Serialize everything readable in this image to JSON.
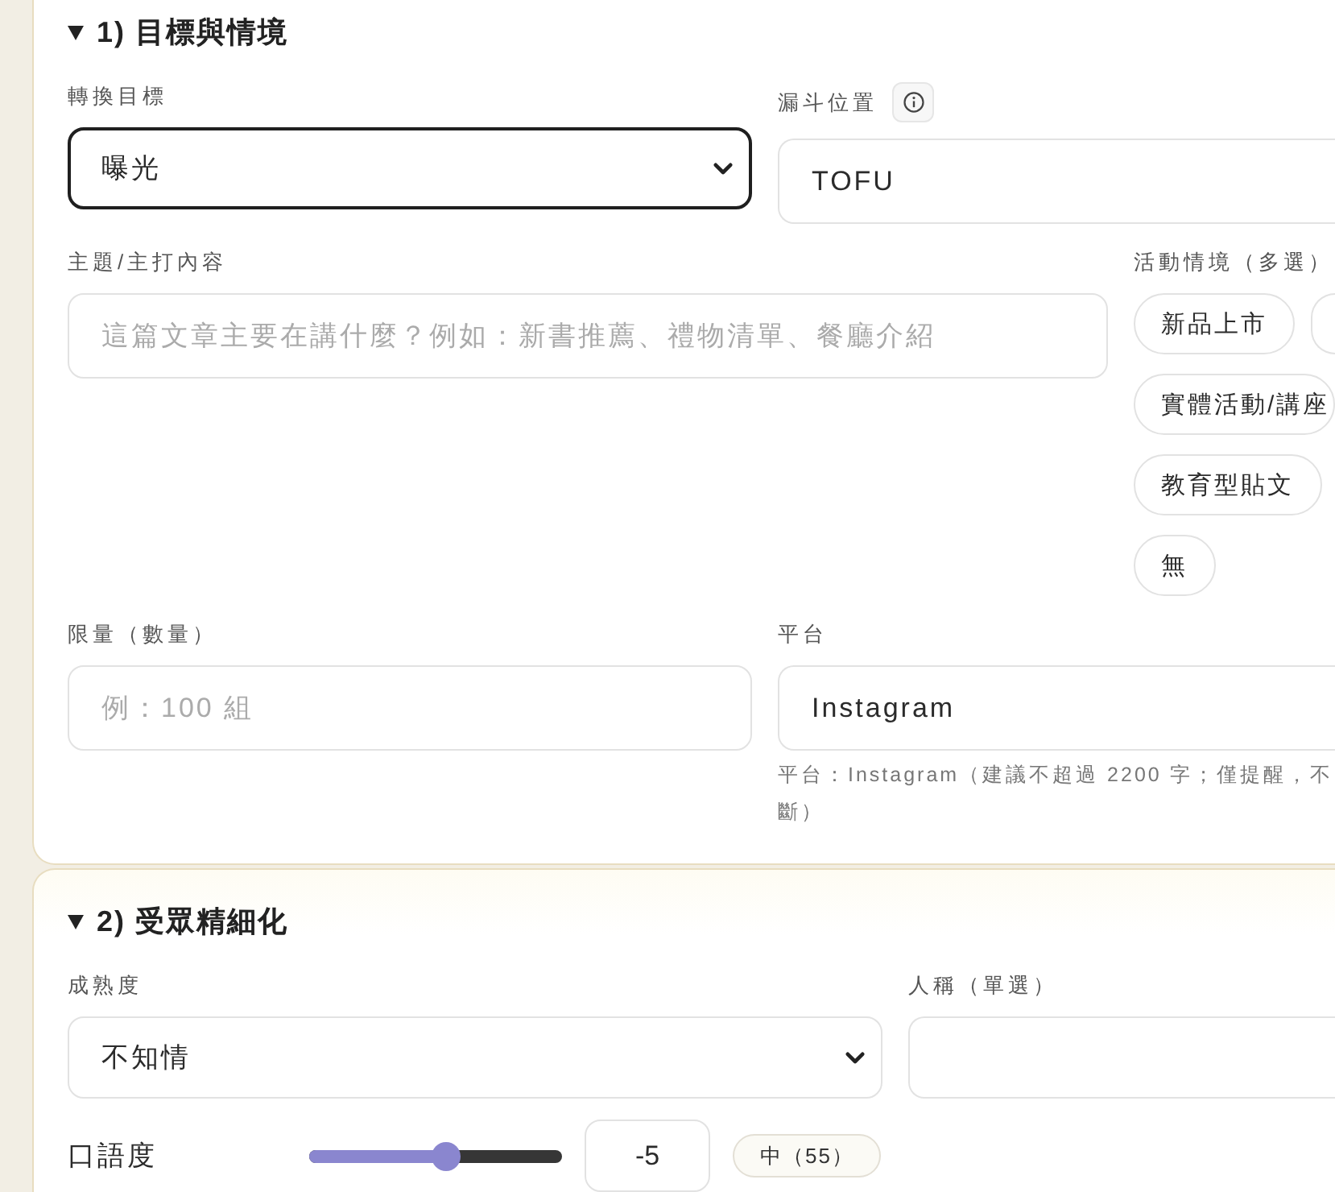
{
  "sections": [
    {
      "title": "1) 目標與情境",
      "expanded": true,
      "rows": [
        {
          "fields": [
            {
              "kind": "select",
              "label": "轉換目標",
              "value": "曝光",
              "focused": true
            },
            {
              "kind": "input",
              "label": "漏斗位置",
              "info": true,
              "value": "TOFU"
            }
          ]
        },
        {
          "fields": [
            {
              "kind": "textarea",
              "label": "主題/主打內容",
              "placeholder": "這篇文章主要在講什麼？例如：新書推薦、禮物清單、餐廳介紹"
            },
            {
              "kind": "chips",
              "label": "活動情境（多選）",
              "chip_rows": [
                [
                  {
                    "label": "新品上市",
                    "selected": false
                  },
                  {
                    "selected": false
                  }
                ],
                [
                  {
                    "label": "實體活動/講座",
                    "selected": false
                  }
                ],
                [
                  {
                    "label": "教育型貼文",
                    "selected": false
                  }
                ],
                [
                  {
                    "label": "無",
                    "selected": false
                  }
                ]
              ]
            }
          ]
        },
        {
          "fields": [
            {
              "kind": "input",
              "label": "限量（數量）",
              "placeholder": "例：100 組"
            },
            {
              "kind": "input",
              "label": "平台",
              "value": "Instagram",
              "hint_lines": [
                "平台：Instagram（建議不超過 2200 字；僅提醒，不",
                "斷）"
              ]
            }
          ]
        }
      ]
    },
    {
      "title": "2) 受眾精細化",
      "expanded": true,
      "rows": [
        {
          "fields": [
            {
              "kind": "select",
              "label": "成熟度",
              "value": "不知情",
              "focused": false
            },
            {
              "kind": "box",
              "label": "人稱（單選）"
            }
          ]
        },
        {
          "fields": [
            {
              "kind": "slider",
              "label": "口語度",
              "level": 0.55,
              "value": "-5",
              "badge": "中（55）"
            }
          ]
        }
      ]
    }
  ]
}
